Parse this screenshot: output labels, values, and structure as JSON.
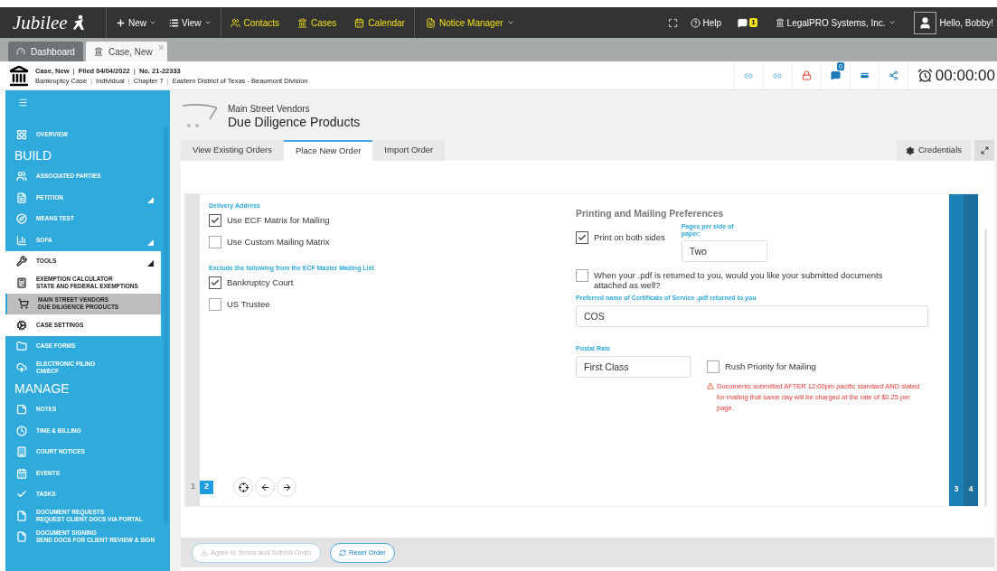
{
  "nav": {
    "logo": "Jubilee",
    "menus": [
      {
        "label": "New"
      },
      {
        "label": "View"
      }
    ],
    "links": [
      {
        "label": "Contacts"
      },
      {
        "label": "Cases"
      },
      {
        "label": "Calendar"
      }
    ],
    "notice_manager": "Notice Manager",
    "help": "Help",
    "messages_badge": "1",
    "firm": "LegalPRO Systems, Inc.",
    "greeting": "Hello, Bobby!"
  },
  "doc_tabs": [
    {
      "label": "Dashboard",
      "selected": false,
      "closable": false
    },
    {
      "label": "Case, New",
      "selected": true,
      "closable": true
    }
  ],
  "close_mark": "×",
  "case_header": {
    "line1": [
      "Case, New",
      "Filed 04/04/2022",
      "No. 21-22333"
    ],
    "line2": [
      "Bankruptcy Case",
      "Individual",
      "Chapter 7",
      "Eastern District of Texas - Beaumont Division"
    ],
    "separator": "|",
    "notes_badge": "0",
    "timer": "00:00:00"
  },
  "sidebar": {
    "items": [
      {
        "kind": "item",
        "label": "OVERVIEW"
      },
      {
        "kind": "heading",
        "label": "BUILD"
      },
      {
        "kind": "item",
        "label": "ASSOCIATED PARTIES"
      },
      {
        "kind": "item",
        "label": "PETITION",
        "expanded": false
      },
      {
        "kind": "item",
        "label": "MEANS TEST"
      },
      {
        "kind": "item",
        "label": "SOFA",
        "expanded": false
      },
      {
        "kind": "item",
        "label": "TOOLS",
        "expanded": true,
        "children": [
          {
            "label": "EXEMPTION CALCULATOR",
            "sublabel": "STATE AND FEDERAL EXEMPTIONS",
            "selected": false
          },
          {
            "label": "MAIN STREET VENDORS",
            "sublabel": "DUE DILIGENCE PRODUCTS",
            "selected": true
          },
          {
            "label": "CASE SETTINGS",
            "selected": false
          }
        ]
      },
      {
        "kind": "item",
        "label": "CASE FORMS"
      },
      {
        "kind": "item",
        "label": "ELECTRONIC FILING",
        "sublabel": "CM/ECF"
      },
      {
        "kind": "heading",
        "label": "MANAGE"
      },
      {
        "kind": "item",
        "label": "NOTES"
      },
      {
        "kind": "item",
        "label": "TIME & BILLING"
      },
      {
        "kind": "item",
        "label": "COURT NOTICES"
      },
      {
        "kind": "item",
        "label": "EVENTS"
      },
      {
        "kind": "item",
        "label": "TASKS"
      },
      {
        "kind": "item",
        "label": "DOCUMENT REQUESTS",
        "sublabel": "REQUEST CLIENT DOCS VIA PORTAL"
      },
      {
        "kind": "item",
        "label": "DOCUMENT SIGNING",
        "sublabel": "SEND DOCS FOR CLIENT REVIEW & SIGN"
      }
    ]
  },
  "page": {
    "subtitle": "Main Street Vendors",
    "title": "Due Diligence Products"
  },
  "tabs": [
    {
      "label": "View Existing Orders",
      "selected": false
    },
    {
      "label": "Place New Order",
      "selected": true
    },
    {
      "label": "Import Order",
      "selected": false
    }
  ],
  "credentials": "Credentials",
  "delivery": {
    "label": "Delivery Address",
    "options": [
      {
        "label": "Use ECF Matrix for Mailing",
        "checked": true
      },
      {
        "label": "Use Custom Mailing Matrix",
        "checked": false
      }
    ]
  },
  "exclude": {
    "label": "Exclude the following from the ECF Master Mailing List",
    "options": [
      {
        "label": "Bankruptcy Court",
        "checked": true
      },
      {
        "label": "US Trustee",
        "checked": false
      }
    ]
  },
  "printing": {
    "heading": "Printing and Mailing Preferences",
    "both_sides": {
      "label": "Print on both sides",
      "checked": true
    },
    "pages_per_side": {
      "label": "Pages per side of paper:",
      "value": "Two"
    },
    "attach": {
      "label": "When your .pdf is returned to you, would you like your submitted documents attached as well?",
      "checked": false
    },
    "cos_name": {
      "label": "Preferred name of Certificate of Service .pdf returned to you",
      "value": "COS"
    },
    "postal_rate": {
      "label": "Postal Rate",
      "value": "First Class"
    },
    "rush": {
      "label": "Rush Priority for Mailing",
      "checked": false
    },
    "warning": "Documents submitted AFTER 12:00pm pacific standard AND slated for mailing that same day will be charged at the rate of $0.25 per page."
  },
  "steps": [
    {
      "label": "1",
      "selected": false
    },
    {
      "label": "2",
      "selected": true
    },
    {
      "label": "3",
      "selected": false
    },
    {
      "label": "4",
      "selected": false
    }
  ],
  "footer_buttons": [
    {
      "label": "Agree to Terms and Submit Order",
      "disabled": true
    },
    {
      "label": "Reset Order",
      "disabled": false
    }
  ]
}
